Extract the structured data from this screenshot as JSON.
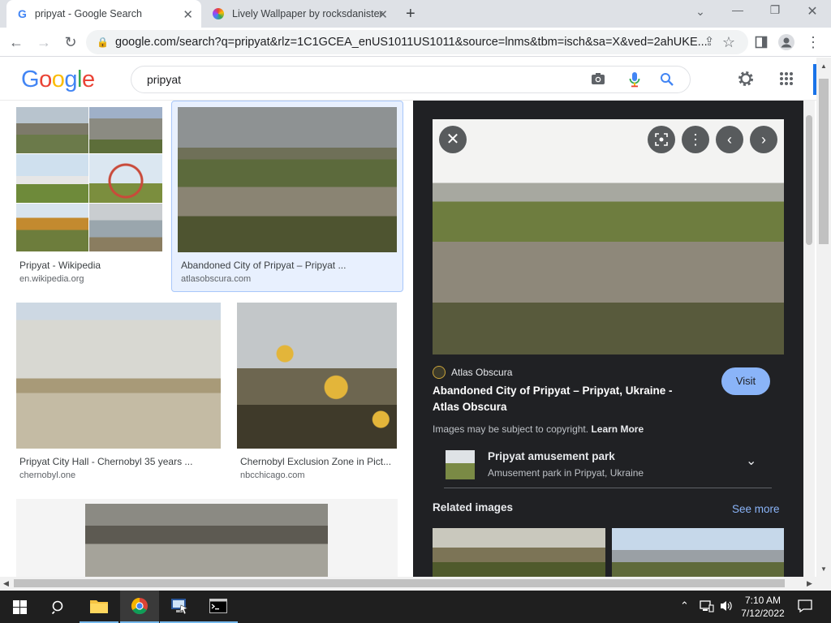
{
  "browser": {
    "tabs": [
      {
        "title": "pripyat - Google Search",
        "favicon": "google-g-icon",
        "active": true
      },
      {
        "title": "Lively Wallpaper by rocksdanister",
        "favicon": "lively-icon",
        "active": false
      }
    ],
    "new_tab_glyph": "+",
    "address": "google.com/search?q=pripyat&rlz=1C1GCEA_enUS1011US1011&source=lnms&tbm=isch&sa=X&ved=2ahUKE..."
  },
  "google": {
    "logo": {
      "letters": [
        "G",
        "o",
        "o",
        "g",
        "l",
        "e"
      ],
      "colors": [
        "#4285f4",
        "#ea4335",
        "#fbbc05",
        "#4285f4",
        "#34a853",
        "#ea4335"
      ]
    },
    "query": "pripyat"
  },
  "results": [
    {
      "caption": "Pripyat - Wikipedia",
      "source": "en.wikipedia.org"
    },
    {
      "caption": "Abandoned City of Pripyat – Pripyat ...",
      "source": "atlasobscura.com"
    },
    {
      "caption": "Pripyat City Hall - Chernobyl 35 years ...",
      "source": "chernobyl.one"
    },
    {
      "caption": "Chernobyl Exclusion Zone in Pict...",
      "source": "nbcchicago.com"
    }
  ],
  "preview": {
    "site": "Atlas Obscura",
    "title": "Abandoned City of Pripyat – Pripyat, Ukraine - Atlas Obscura",
    "visit": "Visit",
    "copyright": "Images may be subject to copyright.",
    "learn_more": "Learn More",
    "entity": {
      "name": "Pripyat amusement park",
      "desc": "Amusement park in Pripyat, Ukraine"
    },
    "related": "Related images",
    "see_more": "See more"
  },
  "taskbar": {
    "time": "7:10 AM",
    "date": "7/12/2022"
  },
  "colors": {
    "accent": "#1a73e8",
    "visit_bg": "#8ab4f8",
    "panel_bg": "#202124"
  }
}
